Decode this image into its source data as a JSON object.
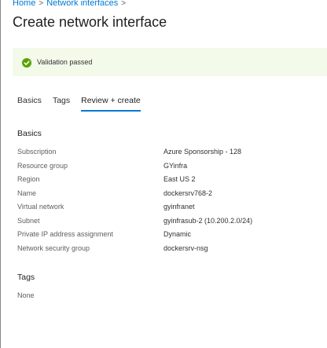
{
  "breadcrumb": [
    {
      "label": "Home"
    },
    {
      "label": "Network interfaces"
    }
  ],
  "page_title": "Create network interface",
  "validation": {
    "status_text": "Validation passed",
    "icon": "check-circle-icon",
    "color": "#57a300",
    "background": "#f3faea"
  },
  "tabs": [
    {
      "label": "Basics",
      "active": false
    },
    {
      "label": "Tags",
      "active": false
    },
    {
      "label": "Review + create",
      "active": true
    }
  ],
  "basics": {
    "title": "Basics",
    "rows": [
      {
        "key": "Subscription",
        "value": "Azure Sponsorship - 128"
      },
      {
        "key": "Resource group",
        "value": "GYinfra"
      },
      {
        "key": "Region",
        "value": "East US 2"
      },
      {
        "key": "Name",
        "value": "dockersrv768-2"
      },
      {
        "key": "Virtual network",
        "value": "gyinfranet"
      },
      {
        "key": "Subnet",
        "value": "gyinfrasub-2 (10.200.2.0/24)"
      },
      {
        "key": "Private IP address assignment",
        "value": "Dynamic"
      },
      {
        "key": "Network security group",
        "value": "dockersrv-nsg"
      }
    ]
  },
  "tags": {
    "title": "Tags",
    "value": "None"
  },
  "colors": {
    "accent": "#0078d4",
    "success": "#57a300"
  }
}
